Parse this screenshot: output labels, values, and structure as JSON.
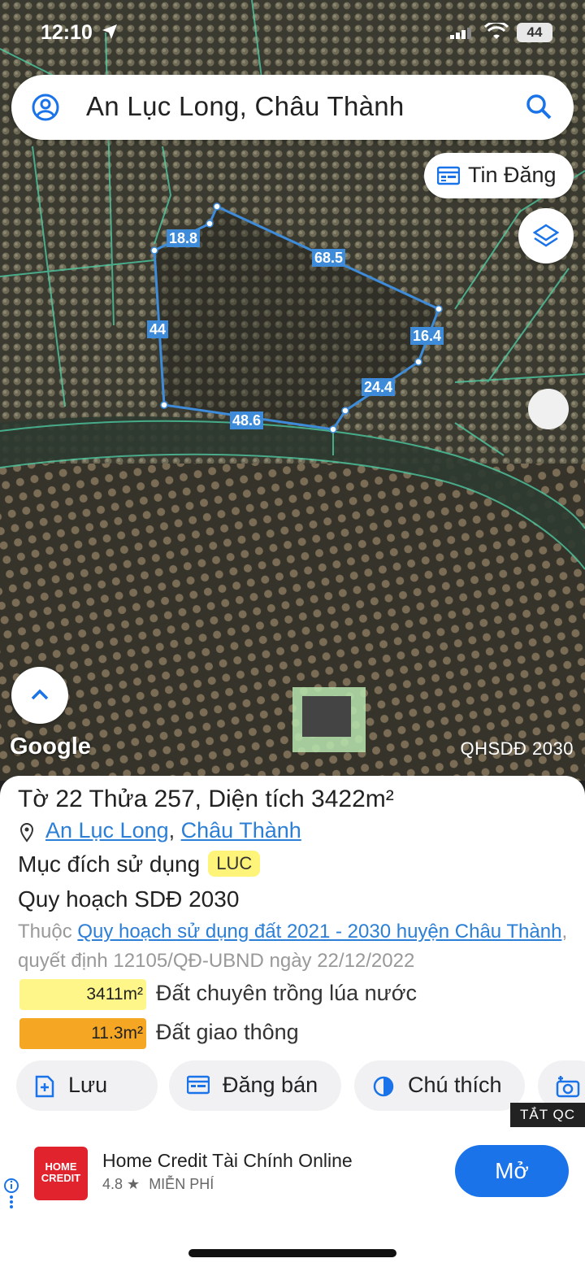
{
  "status_bar": {
    "time": "12:10",
    "battery": "44"
  },
  "search": {
    "query": "An Lục Long, Châu Thành"
  },
  "map": {
    "tin_dang_label": "Tin Đăng",
    "dimensions": [
      "18.8",
      "68.5",
      "44",
      "16.4",
      "24.4",
      "48.6"
    ],
    "google_label": "Google",
    "plan_label": "QHSDĐ 2030"
  },
  "panel": {
    "title": "Tờ 22 Thửa 257, Diện tích 3422m²",
    "address_1": "An Lục Long",
    "address_sep": ", ",
    "address_2": "Châu Thành",
    "purpose_label": "Mục đích sử dụng",
    "purpose_code": "LUC",
    "plan_title": "Quy hoạch SDĐ 2030",
    "note_prefix": "Thuộc ",
    "note_link": "Quy hoạch sử dụng đất 2021 - 2030 huyện Châu Thành",
    "note_suffix": ", quyết định 12105/QĐ-UBND ngày 22/12/2022",
    "areas": [
      {
        "value": "3411m²",
        "label": "Đất chuyên trồng lúa nước",
        "color": "#fff68a"
      },
      {
        "value": "11.3m²",
        "label": "Đất giao thông",
        "color": "#f5a623"
      }
    ],
    "actions": {
      "save": "Lưu",
      "sell": "Đăng bán",
      "legend": "Chú thích"
    }
  },
  "ad": {
    "close_label": "TẮT QC",
    "logo_text": "HOME CREDIT",
    "title": "Home Credit Tài Chính Online",
    "rating": "4.8 ★",
    "price": "MIỄN PHÍ",
    "open_label": "Mở"
  }
}
